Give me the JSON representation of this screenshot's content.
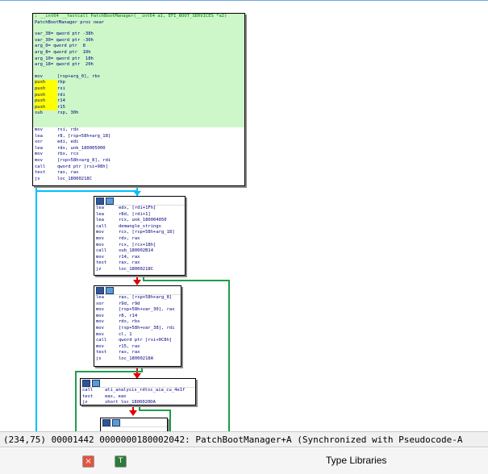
{
  "nodes": {
    "proc": {
      "header_lines": [
        "; __int64 __fastcall PatchBootManager(__int64 a1, EFI_BOOT_SERVICES *a2)",
        "PatchBootManager proc near"
      ],
      "vars": [
        "var_38= qword ptr -38h",
        "var_30= qword ptr -30h",
        "arg_0= qword ptr  8",
        "arg_8= qword ptr  10h",
        "arg_10= qword ptr  18h",
        "arg_18= qword ptr  20h"
      ],
      "instructions": [
        {
          "m": "mov",
          "o": "[rsp+arg_0], rbx"
        },
        {
          "m": "push",
          "o": "rbp"
        },
        {
          "m": "push",
          "o": "rsi"
        },
        {
          "m": "push",
          "o": "rdi"
        },
        {
          "m": "push",
          "o": "r14"
        },
        {
          "m": "push",
          "o": "r15"
        },
        {
          "m": "sub",
          "o": "rsp, 30h"
        },
        {
          "m": "mov",
          "o": "rsi, rdx"
        },
        {
          "m": "lea",
          "o": "r8, [rsp+58h+arg_18]"
        },
        {
          "m": "xor",
          "o": "edi, edi"
        },
        {
          "m": "lea",
          "o": "rdx, unk_180005000"
        },
        {
          "m": "mov",
          "o": "rbx, rcx"
        },
        {
          "m": "mov",
          "o": "[rsp+58h+arg_8], rdi"
        },
        {
          "m": "call",
          "o": "qword ptr [rsi+98h]"
        },
        {
          "m": "test",
          "o": "rax, rax"
        },
        {
          "m": "js",
          "o": "loc_18000218C"
        }
      ]
    },
    "block2": {
      "instructions": [
        {
          "m": "lea",
          "o": "edx, [rdi+1Fh]"
        },
        {
          "m": "lea",
          "o": "r8d, [rdi+1]"
        },
        {
          "m": "lea",
          "o": "rcx, unk_180004050"
        },
        {
          "m": "call",
          "o": "demangle_strings"
        },
        {
          "m": "mov",
          "o": "rcx, [rsp+58h+arg_18]"
        },
        {
          "m": "mov",
          "o": "rdx, rax"
        },
        {
          "m": "mov",
          "o": "rcx, [rcx+18h]"
        },
        {
          "m": "call",
          "o": "sub_180002B14"
        },
        {
          "m": "mov",
          "o": "r14, rax"
        },
        {
          "m": "test",
          "o": "rax, rax"
        },
        {
          "m": "jz",
          "o": "loc_18000218C"
        }
      ]
    },
    "block3": {
      "instructions": [
        {
          "m": "lea",
          "o": "rax, [rsp+58h+arg_8]"
        },
        {
          "m": "xor",
          "o": "r9d, r9d"
        },
        {
          "m": "mov",
          "o": "[rsp+58h+var_30], rax"
        },
        {
          "m": "mov",
          "o": "r8, r14"
        },
        {
          "m": "mov",
          "o": "rdx, rbx"
        },
        {
          "m": "mov",
          "o": "[rsp+58h+var_38], rdi"
        },
        {
          "m": "mov",
          "o": "cl, 1"
        },
        {
          "m": "call",
          "o": "qword ptr [rsi+0C8h]"
        },
        {
          "m": "mov",
          "o": "r15, rax"
        },
        {
          "m": "test",
          "o": "rax, rax"
        },
        {
          "m": "js",
          "o": "loc_18000218A"
        }
      ]
    },
    "block4": {
      "instructions": [
        {
          "m": "call",
          "o": "ati_analysis_rdtsc_aia_cu_4e1f"
        },
        {
          "m": "test",
          "o": "eax, eax"
        },
        {
          "m": "jz",
          "o": "short loc_1800020DA"
        }
      ]
    }
  },
  "status_bar": {
    "text": "(234,75) 00001442 0000000180002042: PatchBootManager+A (Synchronized with Pseudocode-A"
  },
  "bottom_tabs": {
    "close_glyph": "×",
    "tab_icon_glyph": "T",
    "type_libraries_label": "Type Libraries"
  },
  "colors": {
    "node_green": "#cdf7c8",
    "push_highlight": "#ffff00",
    "edge_blue": "#00bfff",
    "edge_green": "#1e9e4a",
    "edge_red": "#e00000"
  }
}
